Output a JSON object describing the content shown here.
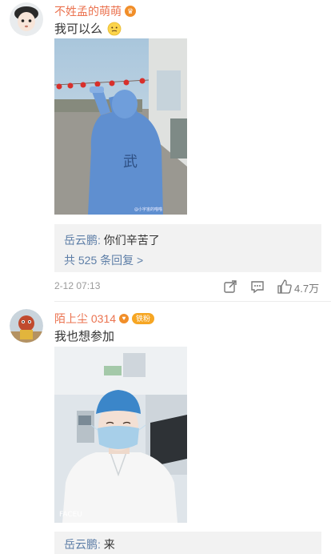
{
  "comments": [
    {
      "username": "不姓孟的萌萌",
      "text": "我可以么",
      "emoji_icon": "thinking-face-icon",
      "photo_watermark": "@小宇宙的喵喵",
      "reply": {
        "author": "岳云鹏",
        "separator": ": ",
        "text": "你们辛苦了",
        "more": "共 525 条回复 >"
      },
      "time": "2-12 07:13",
      "like_count": "4.7万"
    },
    {
      "username": "陌上尘 0314",
      "badge": "铁粉",
      "text": "我也想参加",
      "photo_watermark": "FACEU",
      "reply": {
        "author": "岳云鹏",
        "separator": ": ",
        "text": "来"
      }
    }
  ],
  "colors": {
    "username": "#eb7350",
    "reply_author": "#5d7ea7",
    "reply_bg": "#f2f2f2",
    "meta": "#9a9a9a"
  }
}
